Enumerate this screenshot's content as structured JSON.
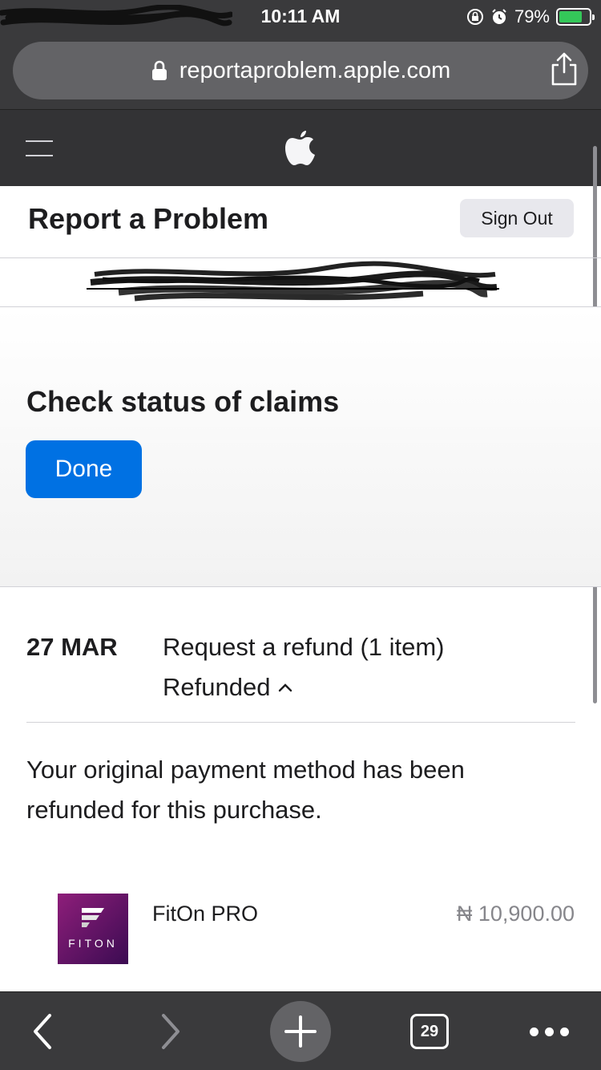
{
  "status_bar": {
    "time": "10:11 AM",
    "battery_percent_label": "79%",
    "battery_level": 0.79,
    "carrier_redacted": true
  },
  "browser": {
    "url": "reportaproblem.apple.com",
    "tab_count": "29"
  },
  "page": {
    "title": "Report a Problem",
    "sign_out_label": "Sign Out",
    "account_email_redacted": true,
    "claims_title": "Check status of claims",
    "done_label": "Done"
  },
  "claim": {
    "date": "27 MAR",
    "type": "Request a refund (1 item)",
    "status": "Refunded",
    "message": "Your original payment method has been refunded for this purchase."
  },
  "item": {
    "icon_text": "FITON",
    "name": "FitOn PRO",
    "price": "₦ 10,900.00"
  },
  "colors": {
    "accent": "#0071e3",
    "chrome": "#3a3a3c",
    "nav": "#333335",
    "battery": "#34c759",
    "app_icon": "#8e1e7a"
  }
}
